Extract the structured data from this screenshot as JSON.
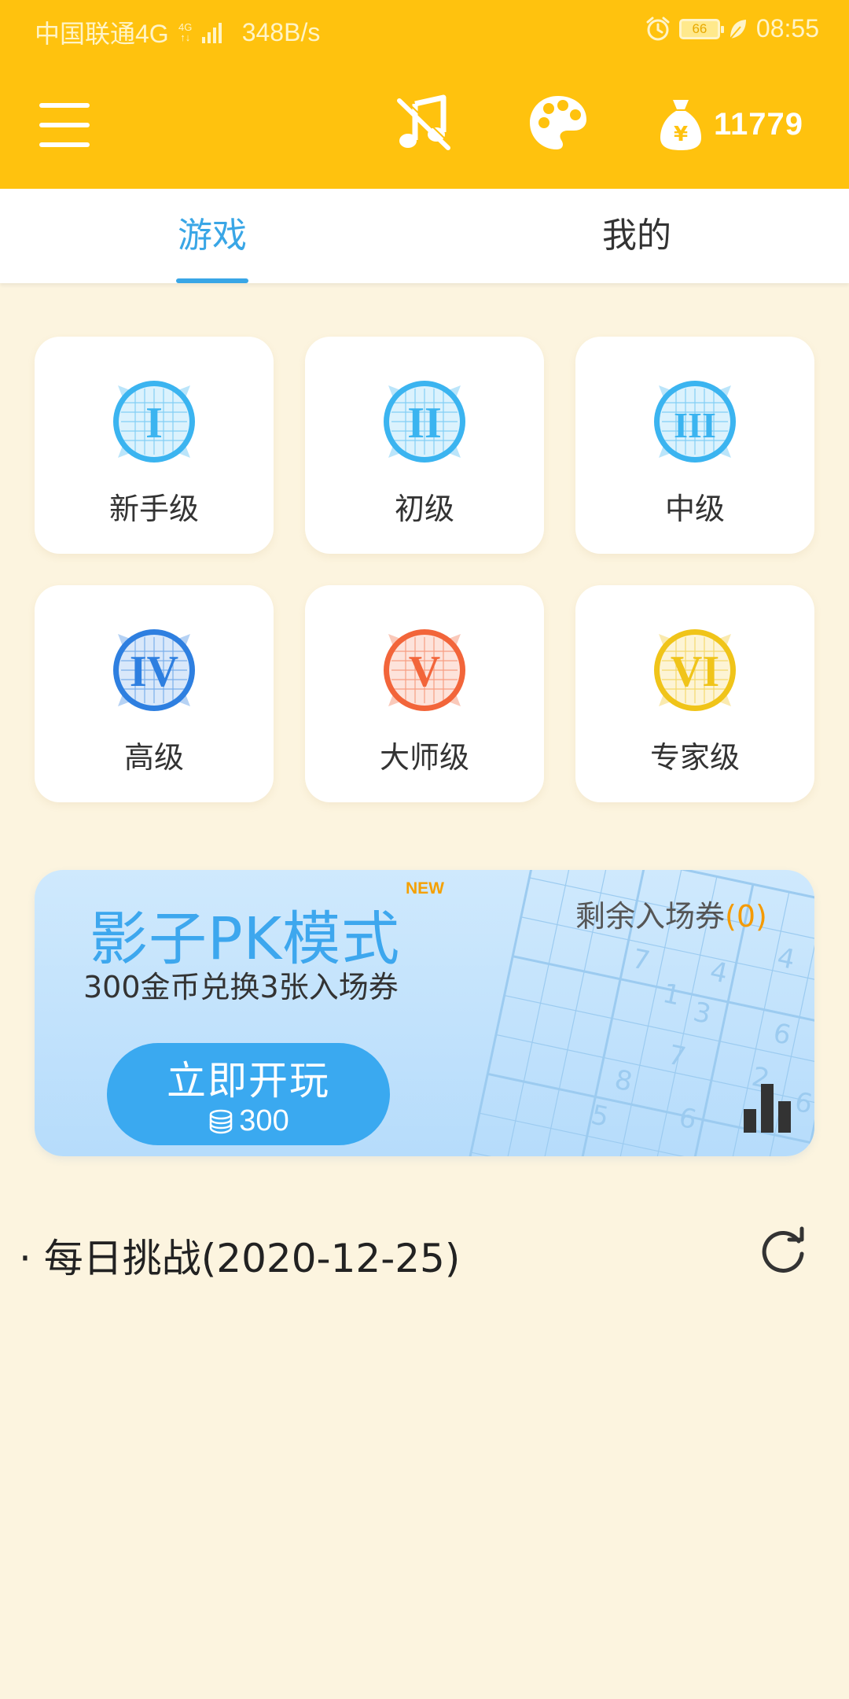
{
  "status_bar": {
    "carrier": "中国联通4G",
    "network_small_top": "4G",
    "network_small_bottom": "↑↓",
    "speed": "348B/s",
    "battery": "66",
    "time": "08:55"
  },
  "app_bar": {
    "coins": "11779",
    "icons": [
      "menu-icon",
      "music-icon",
      "palette-icon",
      "money-bag-icon"
    ]
  },
  "tabs": [
    {
      "label": "游戏",
      "active": true
    },
    {
      "label": "我的",
      "active": false
    }
  ],
  "levels": [
    {
      "numeral": "I",
      "label": "新手级",
      "color": "#3BB4F0"
    },
    {
      "numeral": "II",
      "label": "初级",
      "color": "#3BB4F0"
    },
    {
      "numeral": "III",
      "label": "中级",
      "color": "#3BB4F0"
    },
    {
      "numeral": "IV",
      "label": "高级",
      "color": "#2E7FE0"
    },
    {
      "numeral": "V",
      "label": "大师级",
      "color": "#F2653A"
    },
    {
      "numeral": "VI",
      "label": "专家级",
      "color": "#F0C419"
    }
  ],
  "pk_mode": {
    "title": "影子PK模式",
    "badge": "NEW",
    "subtitle": "300金币兑换3张入场券",
    "tickets_label": "剩余入场券",
    "tickets_count": "(0)",
    "play_label": "立即开玩",
    "play_cost": "300"
  },
  "daily": {
    "label": "· 每日挑战(2020-12-25)"
  },
  "colors": {
    "header": "#FFC20E",
    "background": "#FCF4DF",
    "accent_blue": "#39A6E6",
    "ticket_orange": "#F59A00"
  }
}
